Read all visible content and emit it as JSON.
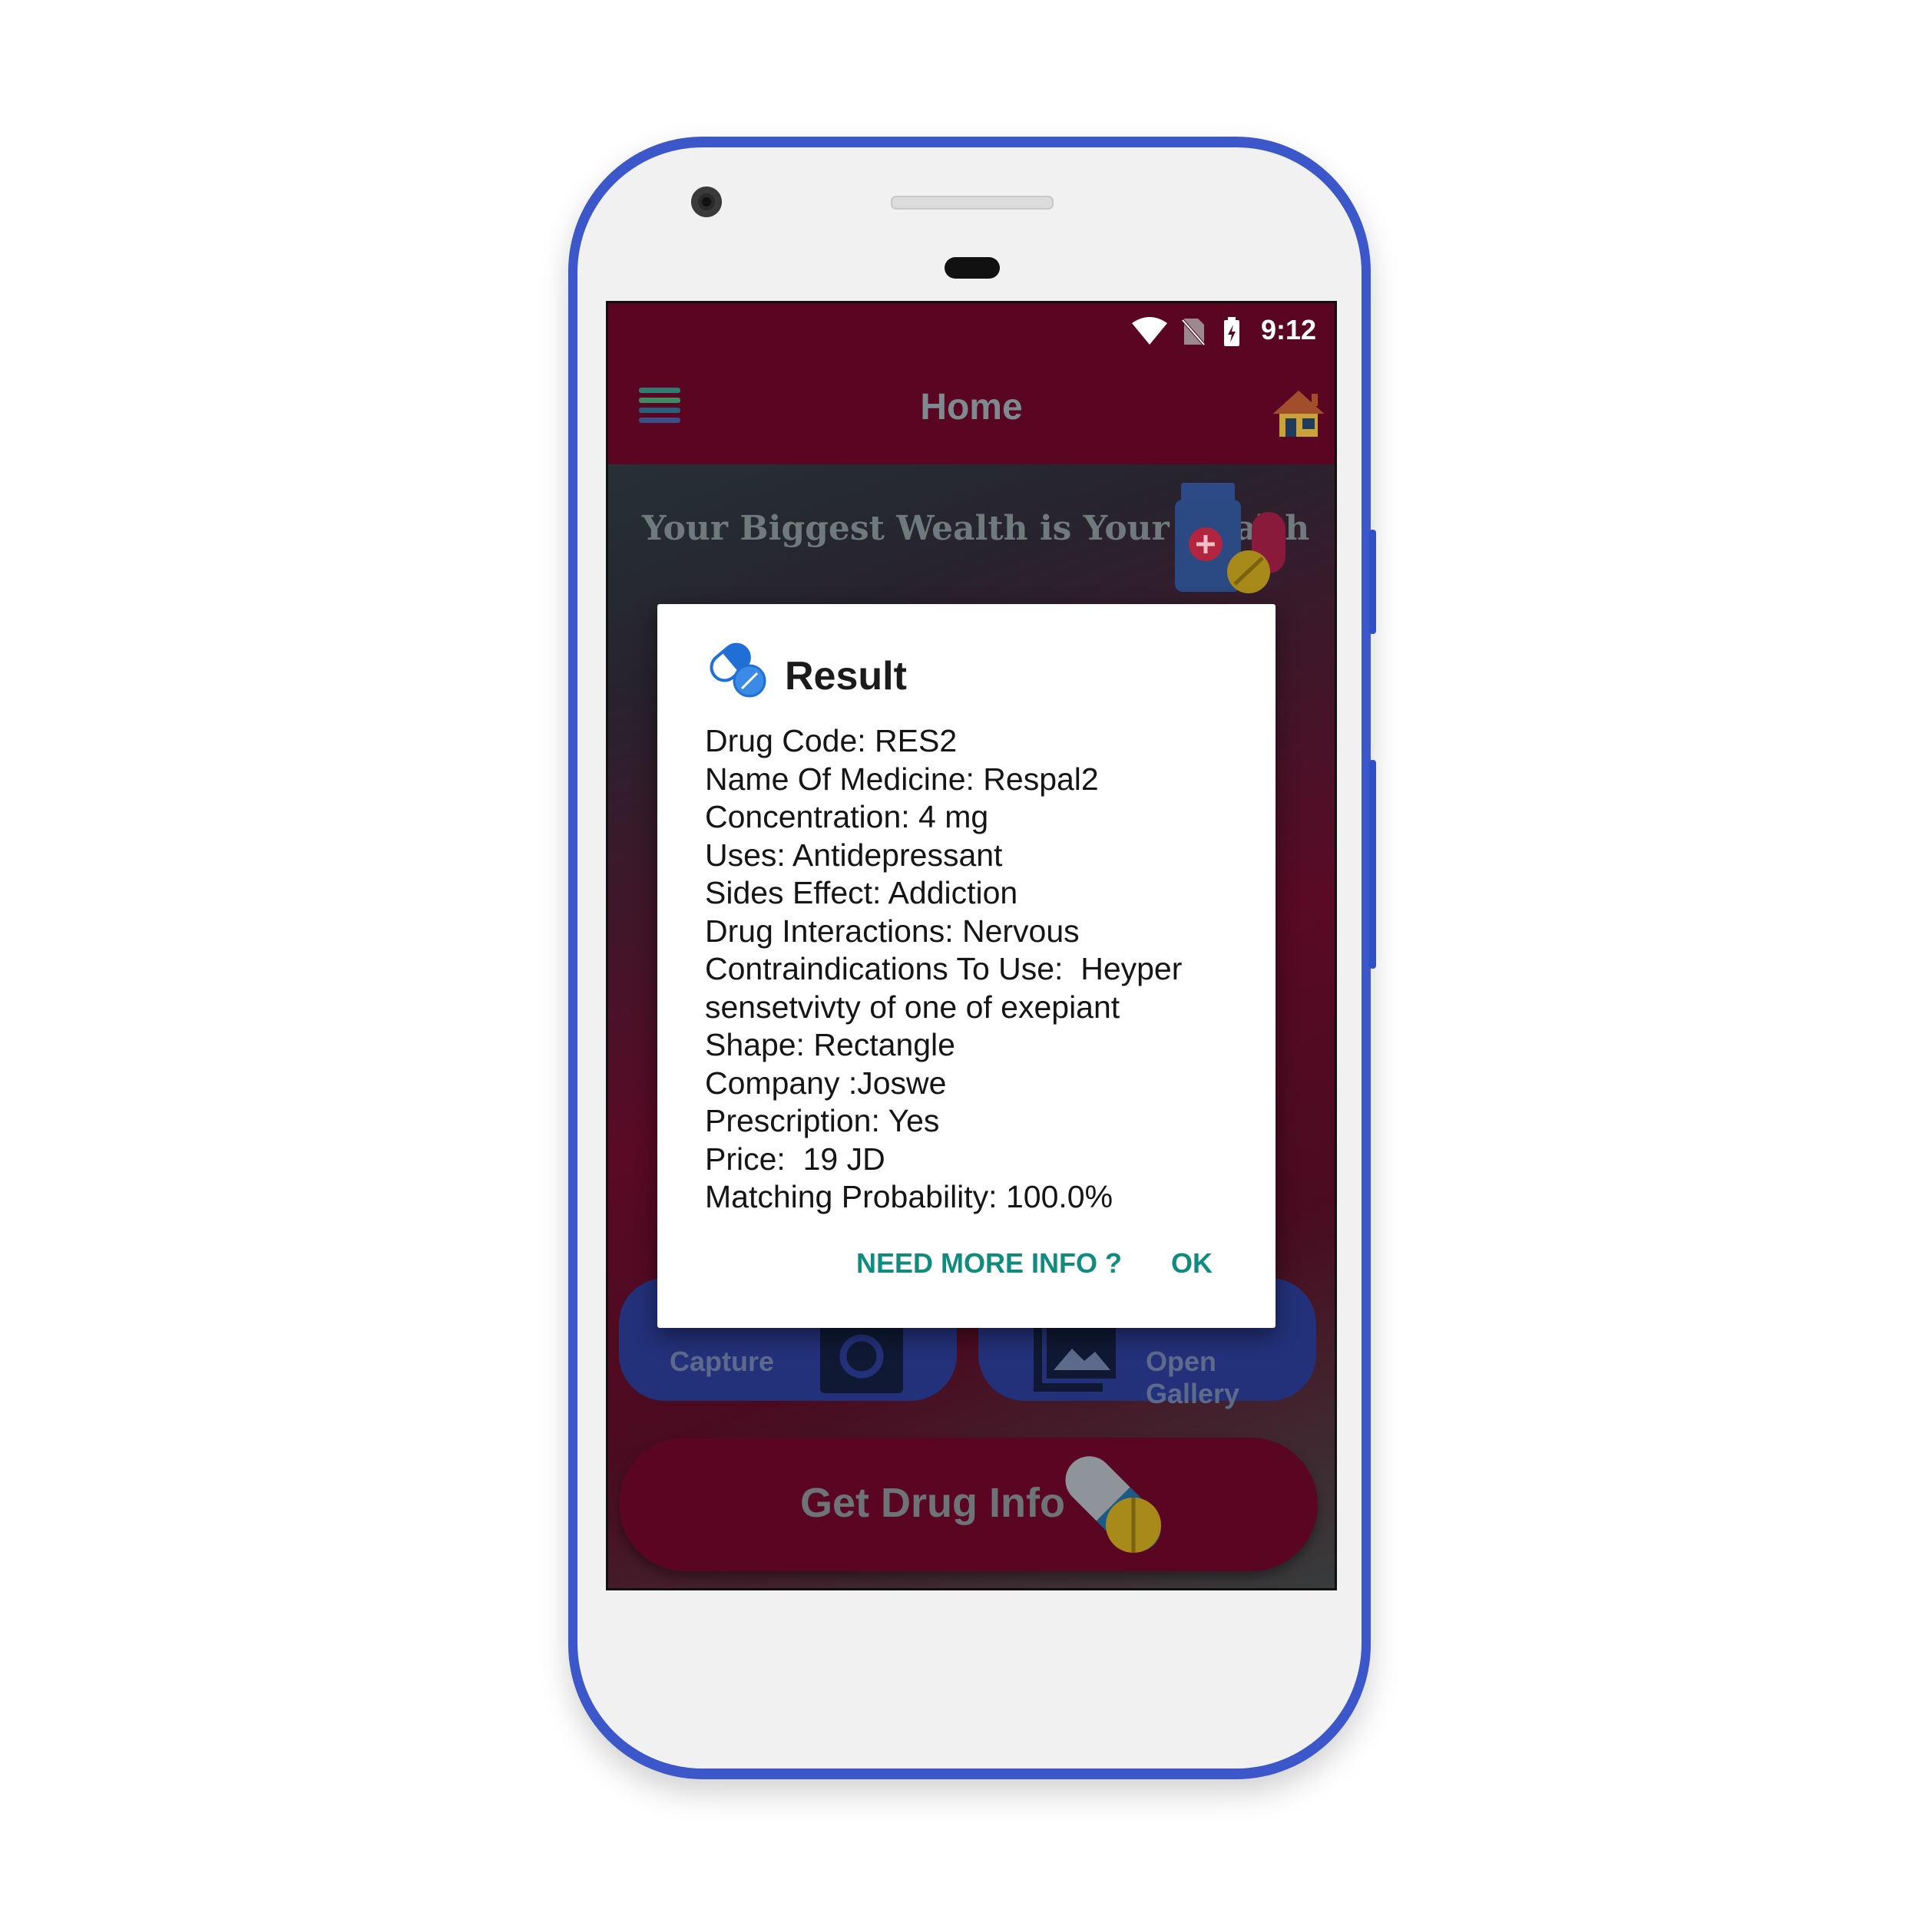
{
  "status_bar": {
    "time": "9:12",
    "icons": [
      "wifi-icon",
      "no-sim-icon",
      "battery-charging-icon"
    ]
  },
  "app_bar": {
    "title": "Home",
    "left_icon": "menu-list-icon",
    "right_icon": "home-icon"
  },
  "banner": {
    "text": "Your Biggest Wealth is Your Health",
    "icon": "medicine-bottle-icon"
  },
  "buttons": {
    "capture": {
      "label": "Capture",
      "icon": "camera-icon"
    },
    "gallery": {
      "label": "Open Gallery",
      "icon": "gallery-icon"
    },
    "get_info": {
      "label": "Get Drug Info",
      "icon": "pills-icon"
    }
  },
  "dialog": {
    "title": "Result",
    "icon": "pills-icon",
    "lines": [
      "Drug Code: RES2",
      "Name Of Medicine: Respal2",
      "Concentration: 4 mg",
      "Uses: Antidepressant",
      "Sides Effect: Addiction",
      "Drug Interactions: Nervous",
      "Contraindications To Use:  Heyper",
      "sensetvivty of one of exepiant",
      "Shape: Rectangle",
      "Company :Joswe",
      "Prescription: Yes",
      "Price:  19 JD",
      "Matching Probability: 100.0%"
    ],
    "actions": {
      "more": "NEED MORE INFO ?",
      "ok": "OK"
    }
  },
  "colors": {
    "app_bar": "#5a0622",
    "dialog_action": "#0f8c7f",
    "phone_frame": "#3b57c9",
    "row_button": "#23317a"
  }
}
